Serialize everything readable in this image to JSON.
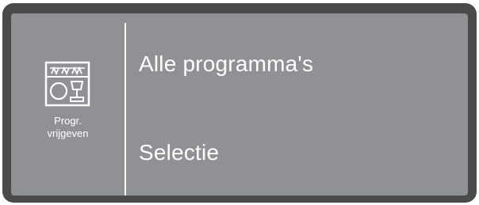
{
  "sidebar": {
    "icon": "dishwasher-program-release-icon",
    "label_line1": "Progr.",
    "label_line2": "vrijgeven"
  },
  "menu": {
    "items": [
      {
        "label": "Alle programma's"
      },
      {
        "label": "Selectie"
      }
    ]
  },
  "colors": {
    "bezel": "#4a4a4a",
    "screen": "#8f9194",
    "foreground": "#ffffff"
  }
}
